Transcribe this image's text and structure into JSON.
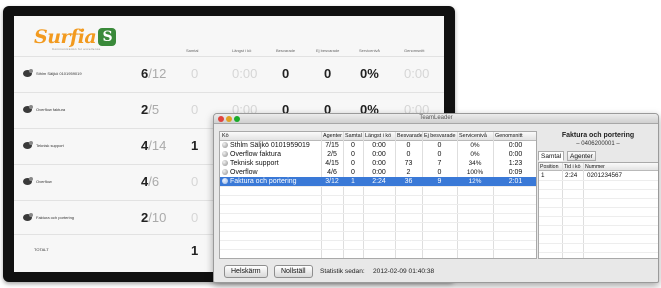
{
  "dashboard": {
    "logo_text": "Surfia",
    "logo_badge": "S",
    "logo_sub": "Communication for excellence",
    "headers": [
      "Samtal",
      "Längst i kö",
      "Besvarade",
      "Ej besvarade",
      "Servicenivå",
      "Genomsnitt"
    ],
    "rows": [
      {
        "name": "Sthlm Säljkö 0101959019",
        "agents": "6",
        "total": "/12",
        "calls": "0",
        "longest": "0:00",
        "answered": "0",
        "unanswered": "0",
        "service": "0%",
        "avg": "0:00"
      },
      {
        "name": "Overflow faktura",
        "agents": "2",
        "total": "/5",
        "calls": "0",
        "longest": "0:00",
        "answered": "0",
        "unanswered": "0",
        "service": "0%",
        "avg": "0:00"
      },
      {
        "name": "Teknisk support",
        "agents": "4",
        "total": "/14",
        "calls": "1",
        "longest": "",
        "answered": "",
        "unanswered": "",
        "service": "",
        "avg": ""
      },
      {
        "name": "Overflow",
        "agents": "4",
        "total": "/6",
        "calls": "0",
        "longest": "",
        "answered": "",
        "unanswered": "",
        "service": "",
        "avg": ""
      },
      {
        "name": "Faktura och portering",
        "agents": "2",
        "total": "/10",
        "calls": "0",
        "longest": "",
        "answered": "",
        "unanswered": "",
        "service": "",
        "avg": ""
      }
    ],
    "total_label": "TOTALT",
    "total_calls": "1"
  },
  "window": {
    "title": "TeamLeader",
    "table_headers": [
      "Kö",
      "Agenter",
      "Samtal",
      "Längst i kö",
      "Besvarade",
      "Ej besvarade",
      "Servicenivå",
      "Genomsnitt"
    ],
    "rows": [
      {
        "name": "Sthlm Säljkö 0101959019",
        "agents": "7/15",
        "calls": "0",
        "longest": "0:00",
        "answered": "0",
        "unanswered": "0",
        "service": "0%",
        "avg": "0:00",
        "selected": false
      },
      {
        "name": "Overflow faktura",
        "agents": "2/5",
        "calls": "0",
        "longest": "0:00",
        "answered": "0",
        "unanswered": "0",
        "service": "0%",
        "avg": "0:00",
        "selected": false
      },
      {
        "name": "Teknisk support",
        "agents": "4/15",
        "calls": "0",
        "longest": "0:00",
        "answered": "73",
        "unanswered": "7",
        "service": "34%",
        "avg": "1:23",
        "selected": false
      },
      {
        "name": "Overflow",
        "agents": "4/6",
        "calls": "0",
        "longest": "0:00",
        "answered": "2",
        "unanswered": "0",
        "service": "100%",
        "avg": "0:09",
        "selected": false
      },
      {
        "name": "Faktura och portering",
        "agents": "3/12",
        "calls": "1",
        "longest": "2:24",
        "answered": "36",
        "unanswered": "9",
        "service": "12%",
        "avg": "2:01",
        "selected": true
      }
    ],
    "detail": {
      "title": "Faktura och portering",
      "subtitle": "– 0406200001 –",
      "tabs": [
        "Samtal",
        "Agenter"
      ],
      "headers": [
        "Position",
        "Tid i kö",
        "Nummer"
      ],
      "rows": [
        {
          "position": "1",
          "time": "2:24",
          "number": "0201234567"
        }
      ]
    },
    "buttons": {
      "fullscreen": "Helskärm",
      "reset": "Nollställ"
    },
    "stats_label": "Statistik sedan:",
    "stats_since": "2012-02-09 01:40:38"
  }
}
